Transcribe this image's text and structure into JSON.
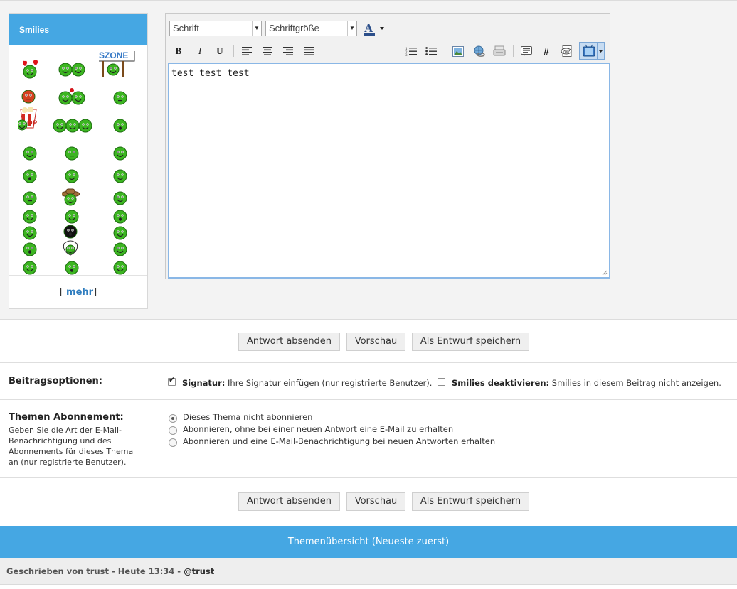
{
  "smilies": {
    "title": "Smilies",
    "more_bracket_open": "[",
    "more_label": "mehr",
    "more_bracket_close": "]",
    "badge_text": "SZONE",
    "popcorn_text": "OP",
    "items": [
      "hearts-smiley-icon",
      "two-smileys-icon",
      "szone-sign-smiley-icon",
      "red-angry-smiley-icon",
      "kissing-smileys-icon",
      "laughing-smiley-icon",
      "popcorn-smiley-icon",
      "group-smileys-icon",
      "shocked-smiley-icon",
      "waving-smiley-icon",
      "pacman-smiley-icon",
      "devil-smiley-icon",
      "sleeping-smiley-icon",
      "rock-smiley-icon",
      "scream-smiley-icon",
      "smile-smiley-icon",
      "cowboy-smiley-icon",
      "grin-smiley-icon",
      "tongue-smiley-icon",
      "neutral-smiley-icon",
      "wink-smiley-icon",
      "squint-smiley-icon",
      "black-smiley-icon",
      "surprised-smiley-icon",
      "crazy-smiley-icon",
      "big-nose-smiley-icon",
      "dizzy-smiley-icon",
      "happy-smiley-icon",
      "pointing-smiley-icon",
      "cheering-smiley-icon"
    ]
  },
  "editor": {
    "font_select": "Schrift",
    "size_select": "Schriftgröße",
    "font_color_letter": "A",
    "bold": "B",
    "italic": "I",
    "underline": "U",
    "hash": "#",
    "content": "test test test"
  },
  "buttons": {
    "submit": "Antwort absenden",
    "preview": "Vorschau",
    "draft": "Als Entwurf speichern"
  },
  "post_options": {
    "label": "Beitragsoptionen:",
    "signature_checked": true,
    "signature_label": "Signatur:",
    "signature_text": "Ihre Signatur einfügen (nur registrierte Benutzer).",
    "disable_smilies_checked": false,
    "disable_smilies_label": "Smilies deaktivieren:",
    "disable_smilies_text": "Smilies in diesem Beitrag nicht anzeigen."
  },
  "subscription": {
    "label": "Themen Abonnement:",
    "description": "Geben Sie die Art der E-Mail-Benachrichtigung und des Abonnements für dieses Thema an (nur registrierte Benutzer).",
    "options": [
      {
        "label": "Dieses Thema nicht abonnieren",
        "selected": true
      },
      {
        "label": "Abonnieren, ohne bei einer neuen Antwort eine E-Mail zu erhalten",
        "selected": false
      },
      {
        "label": "Abonnieren und eine E-Mail-Benachrichtigung bei neuen Antworten erhalten",
        "selected": false
      }
    ]
  },
  "overview": {
    "title": "Themenübersicht (Neueste zuerst)"
  },
  "footer": {
    "posted_by": "Geschrieben von trust - Heute 13:34 - ",
    "user": "@trust"
  },
  "colors": {
    "accent": "#45a7e3",
    "smiley_green": "#3cb521",
    "link": "#2f7dbf"
  }
}
